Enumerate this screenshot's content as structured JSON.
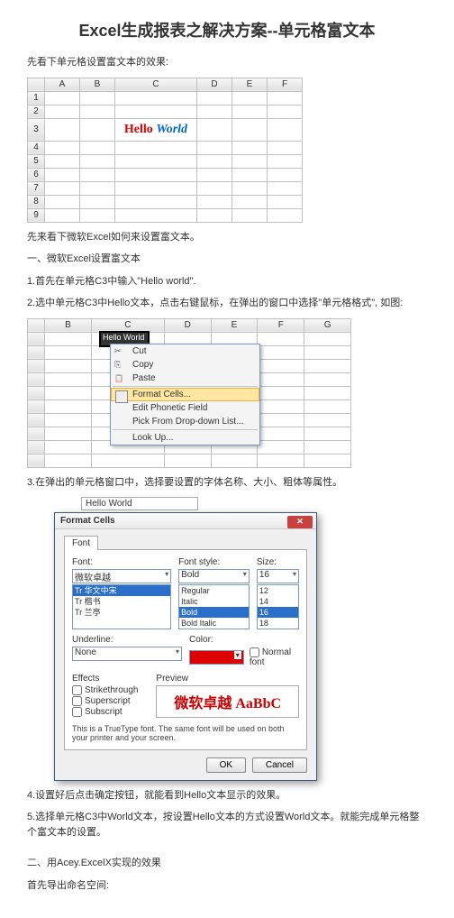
{
  "title": "Excel生成报表之解决方案--单元格富文本",
  "intro": "先看下单元格设置富文本的效果:",
  "sheet1_cols": [
    "A",
    "B",
    "C",
    "D",
    "E",
    "F"
  ],
  "sheet1_rows": [
    "1",
    "2",
    "3",
    "4",
    "5",
    "6",
    "7",
    "8",
    "9"
  ],
  "rich_hello": "Hello",
  "rich_world": "World",
  "p1": "先来看下微软Excel如何来设置富文本。",
  "p2": "一、微软Excel设置富文本",
  "p3": "1.首先在单元格C3中输入\"Hello world\".",
  "p4": "2.选中单元格C3中Hello文本，点击右键鼠标，在弹出的窗口中选择\"单元格格式\", 如图:",
  "sheet2_cols": [
    "B",
    "C",
    "D",
    "E",
    "F",
    "G"
  ],
  "sheet2_rows": [
    "",
    "",
    "",
    "",
    "",
    "",
    "",
    "",
    "",
    "",
    ""
  ],
  "sel_cell_text": "Hello World",
  "ctx": {
    "cut": "Cut",
    "copy": "Copy",
    "paste": "Paste",
    "format": "Format Cells...",
    "phonetic": "Edit Phonetic Field",
    "pick": "Pick From Drop-down List...",
    "lookup": "Look Up..."
  },
  "p5": "3.在弹出的单元格窗口中，选择要设置的字体名称、大小、粗体等属性。",
  "formula_bar": "Hello World",
  "dlg": {
    "title": "Format Cells",
    "tab_font": "Font",
    "lbl_font": "Font:",
    "lbl_style": "Font style:",
    "lbl_size": "Size:",
    "font_val": "微软卓越",
    "font_opts": [
      "Tr 华文中宋",
      "Tr 楷书",
      "Tr 兰亭"
    ],
    "style_val": "Bold",
    "style_opts": [
      "Regular",
      "Italic",
      "Bold",
      "Bold Italic"
    ],
    "size_val": "16",
    "size_opts": [
      "12",
      "14",
      "16",
      "18"
    ],
    "lbl_underline": "Underline:",
    "underline_val": "None",
    "lbl_color": "Color:",
    "normal_font": "Normal font",
    "lbl_effects": "Effects",
    "fx_strike": "Strikethrough",
    "fx_super": "Superscript",
    "fx_sub": "Subscript",
    "lbl_preview": "Preview",
    "preview_text": "微软卓越  AaBbC",
    "note": "This is a TrueType font. The same font will be used on both your printer and your screen.",
    "ok": "OK",
    "cancel": "Cancel"
  },
  "p6": "4.设置好后点击确定按钮，就能看到Hello文本显示的效果。",
  "p7": "5.选择单元格C3中World文本，按设置Hello文本的方式设置World文本。就能完成单元格整个富文本的设置。",
  "p8": "二、用Acey.ExcelX实现的效果",
  "p9": "首先导出命名空间:"
}
